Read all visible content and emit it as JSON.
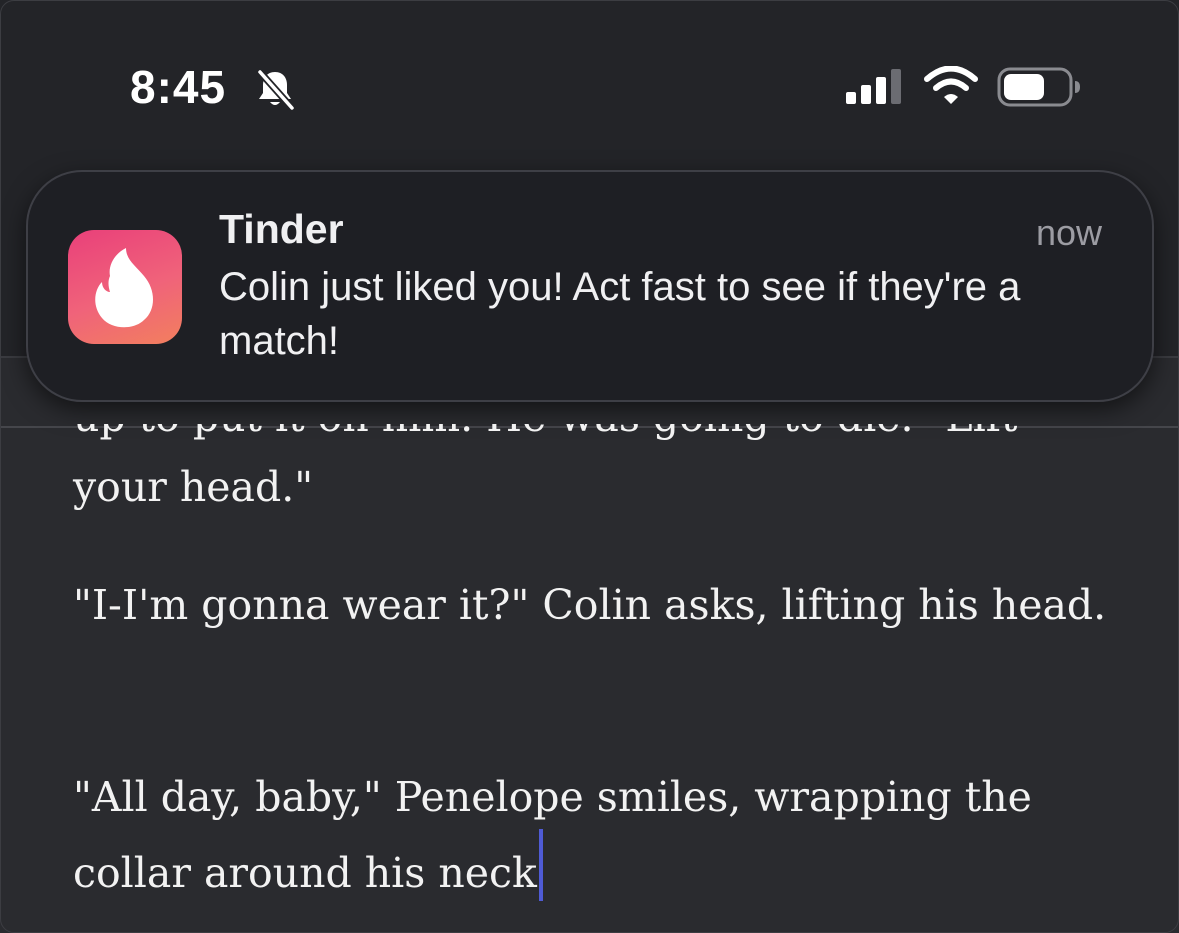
{
  "status_bar": {
    "time": "8:45",
    "bell_icon": "bell-slash-icon",
    "signal_icon": "cellular-signal-icon",
    "wifi_icon": "wifi-icon",
    "battery_icon": "battery-icon"
  },
  "notification": {
    "app_name": "Tinder",
    "time": "now",
    "body": "Colin just liked you! Act fast to see if they're a match!",
    "app_icon": "tinder-flame-icon",
    "icon_colors": [
      "#e9407a",
      "#f27f5e"
    ]
  },
  "document": {
    "partial_line": "up to put it on him. He was going to die. \"Lift",
    "paragraphs": [
      "your head.\"",
      "\"I-I'm gonna wear it?\" Colin asks, lifting his head.",
      "\"All day, baby,\" Penelope smiles, wrapping the collar around his neck"
    ]
  },
  "colors": {
    "background": "#2a2b2f",
    "text": "#f2f2f2",
    "cursor": "#4f5bd5"
  }
}
